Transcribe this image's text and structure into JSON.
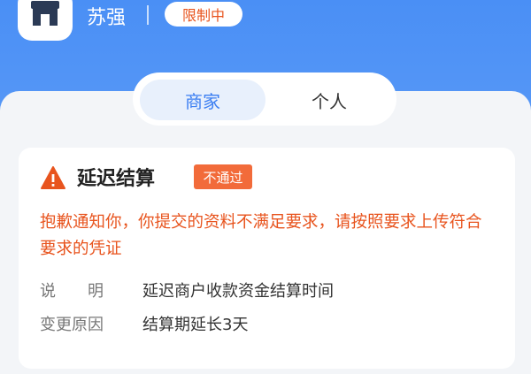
{
  "header": {
    "merchant_name": "苏强",
    "status_badge": "限制中",
    "avatar_icon": "store-icon"
  },
  "tabs": [
    {
      "label": "商家",
      "active": true
    },
    {
      "label": "个人",
      "active": false
    }
  ],
  "card": {
    "icon": "warning-icon",
    "title": "延迟结算",
    "badge": "不通过",
    "message": "抱歉通知你，你提交的资料不满足要求，请按照要求上传符合要求的凭证",
    "details": [
      {
        "label": "说　　明",
        "value": "延迟商户收款资金结算时间"
      },
      {
        "label": "变更原因",
        "value": "结算期延长3天"
      },
      {
        "label": "",
        "value": ""
      }
    ]
  },
  "colors": {
    "primary": "#3c7ff2",
    "warning": "#e8541e",
    "badge_bg": "#f26b3a"
  }
}
